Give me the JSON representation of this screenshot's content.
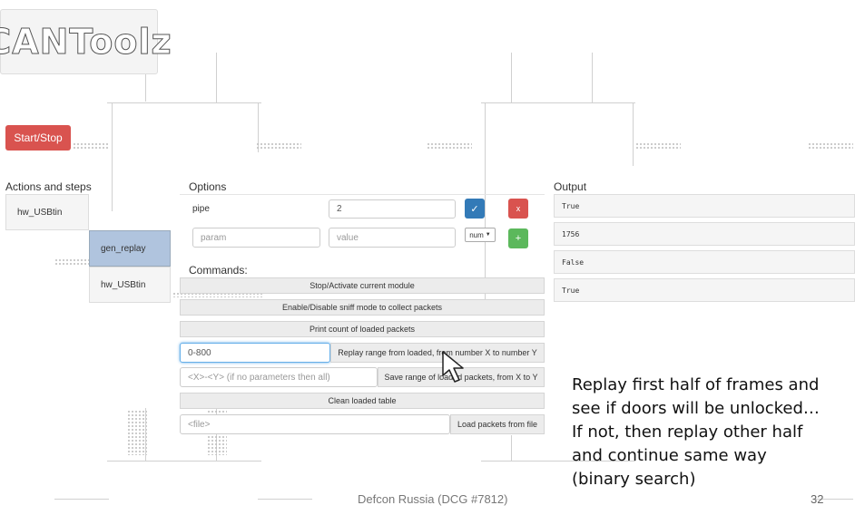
{
  "logo": {
    "text": "CANToolz"
  },
  "controls": {
    "start_stop_label": "Start/Stop"
  },
  "actions": {
    "title": "Actions and steps",
    "items": [
      "hw_USBtin",
      "gen_replay",
      "hw_USBtin"
    ]
  },
  "options": {
    "title": "Options",
    "rows": [
      {
        "name": "pipe",
        "value": "2"
      }
    ],
    "new_param_placeholder": "param",
    "new_value_placeholder": "value",
    "type_select": "num"
  },
  "commands": {
    "title": "Commands:",
    "stop_activate": "Stop/Activate current module",
    "sniff": "Enable/Disable sniff mode to collect packets",
    "print_count": "Print count of loaded packets",
    "replay_input_value": "0-800",
    "replay_label": "Replay range from loaded, from number X to number Y",
    "save_placeholder": "<X>-<Y> (if no parameters then all)",
    "save_label": "Save range of loaded packets, from X to Y",
    "clean": "Clean loaded table",
    "file_placeholder": "<file>",
    "load_label": "Load packets from file"
  },
  "output": {
    "title": "Output",
    "rows": [
      "True",
      "1756",
      "False",
      "True"
    ]
  },
  "annotation": {
    "lines": [
      "Replay first half of frames and",
      "see if doors will be unlocked…",
      "If not, then replay other half",
      "and continue same way",
      "(binary search)"
    ]
  },
  "footer": {
    "text": "Defcon Russia (DCG #7812)",
    "page": "32"
  },
  "colors": {
    "danger": "#d9534f",
    "primary": "#337ab7",
    "success": "#5cb85c",
    "active": "#b0c4de"
  }
}
